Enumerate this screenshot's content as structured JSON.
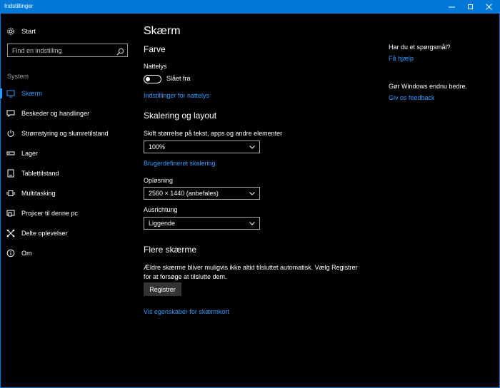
{
  "window": {
    "title": "Indstillinger",
    "controls": [
      "minimize-icon",
      "maximize-icon",
      "close-icon"
    ],
    "accent_color": "#0078d7"
  },
  "sidebar": {
    "home_label": "Start",
    "home_icon": "gear-icon",
    "search_placeholder": "Find en indstilling",
    "search_icon": "search-icon",
    "section_label": "System",
    "items": [
      {
        "label": "Skærm",
        "icon": "display-icon",
        "active": true
      },
      {
        "label": "Beskeder og handlinger",
        "icon": "message-icon",
        "active": false
      },
      {
        "label": "Strømstyring og slumretilstand",
        "icon": "power-icon",
        "active": false
      },
      {
        "label": "Lager",
        "icon": "storage-icon",
        "active": false
      },
      {
        "label": "Tablettilstand",
        "icon": "tablet-icon",
        "active": false
      },
      {
        "label": "Multitasking",
        "icon": "multitasking-icon",
        "active": false
      },
      {
        "label": "Projicer til denne pc",
        "icon": "project-icon",
        "active": false
      },
      {
        "label": "Delte oplevelser",
        "icon": "share-icon",
        "active": false
      },
      {
        "label": "Om",
        "icon": "info-icon",
        "active": false
      }
    ],
    "active_color": "#2e9bff"
  },
  "main": {
    "title": "Skærm",
    "color_section": {
      "heading": "Farve",
      "nightlight_label": "Nattelys",
      "nightlight_state": "Slået fra",
      "nightlight_on": false,
      "nightlight_link": "Indstillinger for nattelys"
    },
    "scale_section": {
      "heading": "Skalering og layout",
      "size_label": "Skift størrelse på tekst, apps og andre elementer",
      "size_value": "100%",
      "custom_scaling_link": "Brugerdefineret skalering",
      "resolution_label": "Opløsning",
      "resolution_value": "2560 × 1440 (anbefales)",
      "orientation_label": "Ausrichtung",
      "orientation_value": "Liggende"
    },
    "multi_section": {
      "heading": "Flere skærme",
      "description": "Ældre skærme bliver muligvis ikke altid tilsluttet automatisk. Vælg Registrer for at forsøge at tilslutte dem.",
      "button_label": "Registrer",
      "adapter_link": "Vis egenskaber for skærmkort"
    }
  },
  "right_panel": {
    "question": "Har du et spørgsmål?",
    "help_link": "Få hjælp",
    "improve": "Gør Windows endnu bedre.",
    "feedback_link": "Giv os feedback"
  }
}
